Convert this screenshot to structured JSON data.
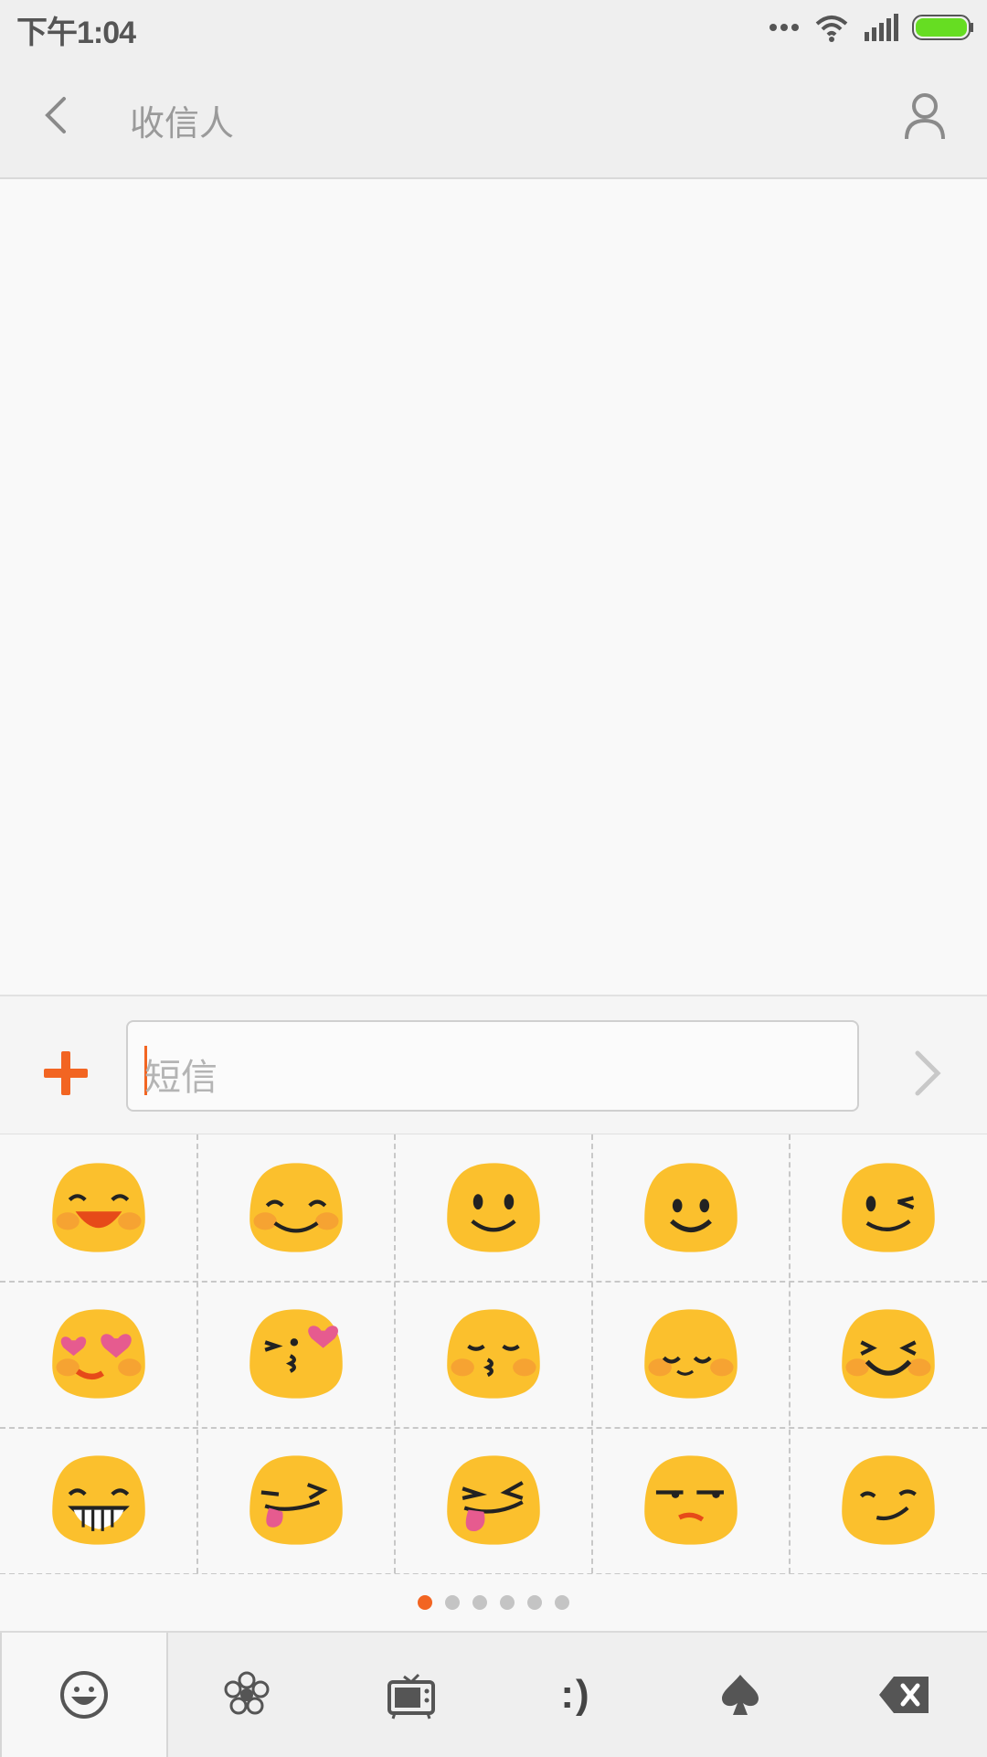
{
  "status_bar": {
    "time": "下午1:04"
  },
  "header": {
    "title": "收信人"
  },
  "composer": {
    "placeholder": "短信"
  },
  "emoji_page": {
    "pages": 6,
    "active_page": 1
  },
  "emoji": [
    "smiling-face-open-mouth",
    "smiling-face-smiling-eyes",
    "slightly-smiling-face",
    "smiling-face",
    "winking-face",
    "heart-eyes-face",
    "face-blowing-kiss",
    "kissing-face-closed-eyes",
    "relieved-face",
    "squinting-smile-face",
    "grinning-face-big-teeth",
    "winking-face-tongue",
    "squinting-face-tongue",
    "unamused-face",
    "smirking-face"
  ],
  "categories": {
    "text_smiley": ":)"
  },
  "colors": {
    "accent": "#f26522",
    "battery": "#66dd22",
    "emoji_yellow": "#fbc02d"
  }
}
